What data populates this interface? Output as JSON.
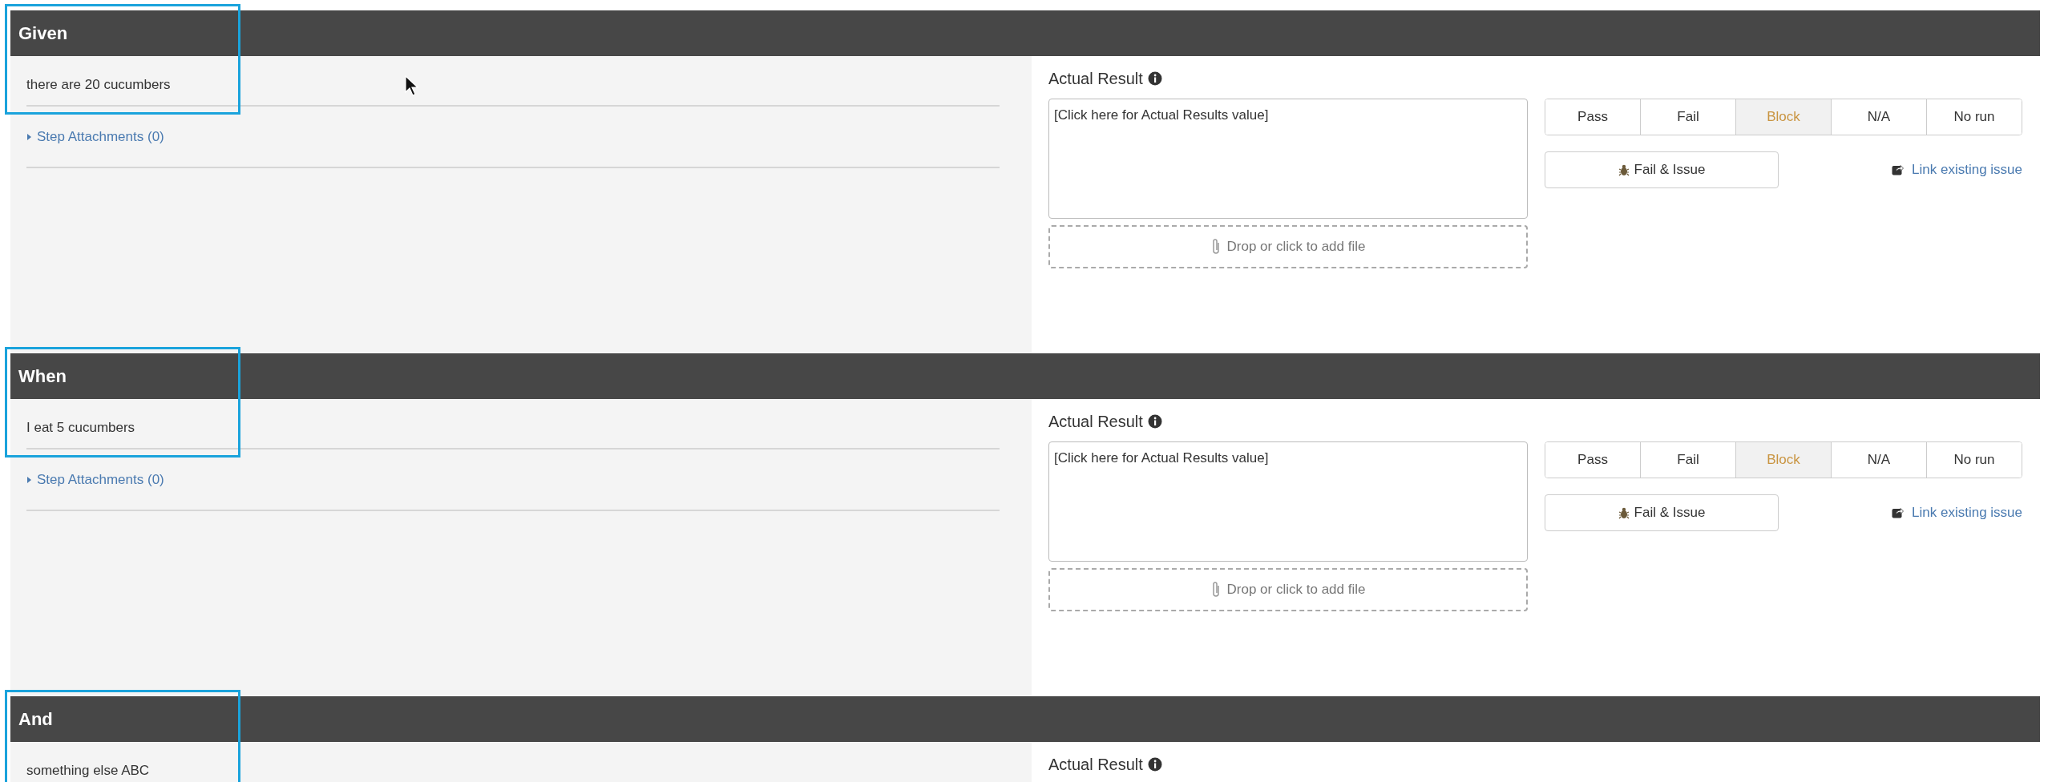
{
  "steps": [
    {
      "title": "Given",
      "highlighted": true,
      "text": "there are 20 cucumbers",
      "attachments": "Step Attachments (0)",
      "actual_label": "Actual Result",
      "actual_placeholder": "[Click here for Actual Results value]",
      "dropzone": "Drop or click to add file",
      "statuses": [
        {
          "label": "Pass",
          "selected": false
        },
        {
          "label": "Fail",
          "selected": false
        },
        {
          "label": "Block",
          "selected": true
        },
        {
          "label": "N/A",
          "selected": false
        },
        {
          "label": "No run",
          "selected": false
        }
      ],
      "fail_issue": "Fail & Issue",
      "link_issue": "Link existing issue",
      "cursor": true
    },
    {
      "title": "When",
      "highlighted": true,
      "text": "I eat 5 cucumbers",
      "attachments": "Step Attachments (0)",
      "actual_label": "Actual Result",
      "actual_placeholder": "[Click here for Actual Results value]",
      "dropzone": "Drop or click to add file",
      "statuses": [
        {
          "label": "Pass",
          "selected": false
        },
        {
          "label": "Fail",
          "selected": false
        },
        {
          "label": "Block",
          "selected": true
        },
        {
          "label": "N/A",
          "selected": false
        },
        {
          "label": "No run",
          "selected": false
        }
      ],
      "fail_issue": "Fail & Issue",
      "link_issue": "Link existing issue",
      "cursor": false
    },
    {
      "title": "And",
      "highlighted": true,
      "text": "something else ABC",
      "actual_label": "Actual Result",
      "cursor": false
    }
  ]
}
